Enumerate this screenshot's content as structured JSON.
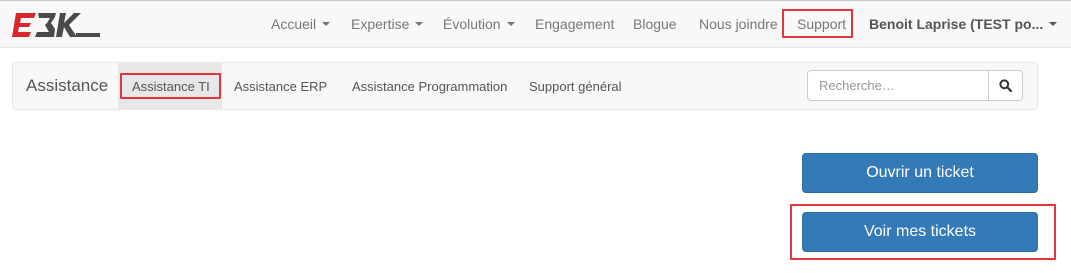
{
  "brand": {
    "logo_text": "E3K"
  },
  "topnav": {
    "items": [
      {
        "label": "Accueil",
        "dropdown": true
      },
      {
        "label": "Expertise",
        "dropdown": true
      },
      {
        "label": "Évolution",
        "dropdown": true
      },
      {
        "label": "Engagement",
        "dropdown": false
      },
      {
        "label": "Blogue",
        "dropdown": false
      },
      {
        "label": "Nous joindre",
        "dropdown": false
      },
      {
        "label": "Support",
        "dropdown": false,
        "highlighted": true
      }
    ],
    "user": {
      "label": "Benoit Laprise (TEST po...",
      "dropdown": true
    }
  },
  "subnav": {
    "brand": "Assistance",
    "items": [
      {
        "label": "Assistance TI",
        "active": true,
        "highlighted": true
      },
      {
        "label": "Assistance ERP"
      },
      {
        "label": "Assistance Programmation"
      },
      {
        "label": "Support général"
      }
    ],
    "search": {
      "placeholder": "Recherche…",
      "value": "",
      "icon": "search-icon"
    }
  },
  "actions": {
    "open_ticket": "Ouvrir un ticket",
    "view_tickets": "Voir mes tickets"
  },
  "colors": {
    "primary": "#337ab7",
    "highlight": "#e0363c",
    "logo_red": "#d9262a",
    "logo_dark": "#4a4a4a"
  },
  "icons": [
    "caret-down-icon",
    "search-icon"
  ]
}
